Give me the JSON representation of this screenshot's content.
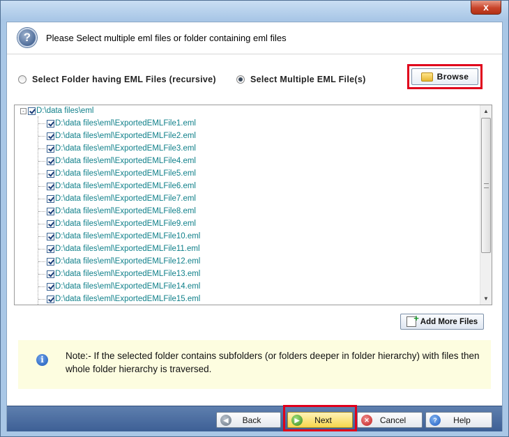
{
  "window": {
    "close_glyph": "x"
  },
  "header": {
    "icon": "help-circle-icon",
    "text": "Please Select multiple eml files or folder containing eml files"
  },
  "options": {
    "folder_label": "Select Folder having EML Files (recursive)",
    "multiple_label": "Select Multiple EML File(s)",
    "selected": "multiple"
  },
  "browse": {
    "label": "Browse",
    "icon": "folder-open-icon"
  },
  "tree": {
    "root": {
      "expander": "-",
      "label": "D:\\data files\\eml",
      "checked": true
    },
    "items": [
      "D:\\data files\\eml\\ExportedEMLFile1.eml",
      "D:\\data files\\eml\\ExportedEMLFile2.eml",
      "D:\\data files\\eml\\ExportedEMLFile3.eml",
      "D:\\data files\\eml\\ExportedEMLFile4.eml",
      "D:\\data files\\eml\\ExportedEMLFile5.eml",
      "D:\\data files\\eml\\ExportedEMLFile6.eml",
      "D:\\data files\\eml\\ExportedEMLFile7.eml",
      "D:\\data files\\eml\\ExportedEMLFile8.eml",
      "D:\\data files\\eml\\ExportedEMLFile9.eml",
      "D:\\data files\\eml\\ExportedEMLFile10.eml",
      "D:\\data files\\eml\\ExportedEMLFile11.eml",
      "D:\\data files\\eml\\ExportedEMLFile12.eml",
      "D:\\data files\\eml\\ExportedEMLFile13.eml",
      "D:\\data files\\eml\\ExportedEMLFile14.eml",
      "D:\\data files\\eml\\ExportedEMLFile15.eml"
    ]
  },
  "add_more": {
    "label": "Add More Files",
    "icon": "add-file-icon"
  },
  "note": {
    "icon": "info-icon",
    "text": "Note:- If the selected folder contains subfolders (or folders deeper in folder hierarchy) with files then whole folder hierarchy is traversed."
  },
  "footer": {
    "back_label": "Back",
    "next_label": "Next",
    "cancel_label": "Cancel",
    "help_label": "Help"
  },
  "colors": {
    "highlight": "#e0001b",
    "tree_text": "#10808a",
    "note_bg": "#fdfde0",
    "footer_bg": "#4d6fa2"
  }
}
